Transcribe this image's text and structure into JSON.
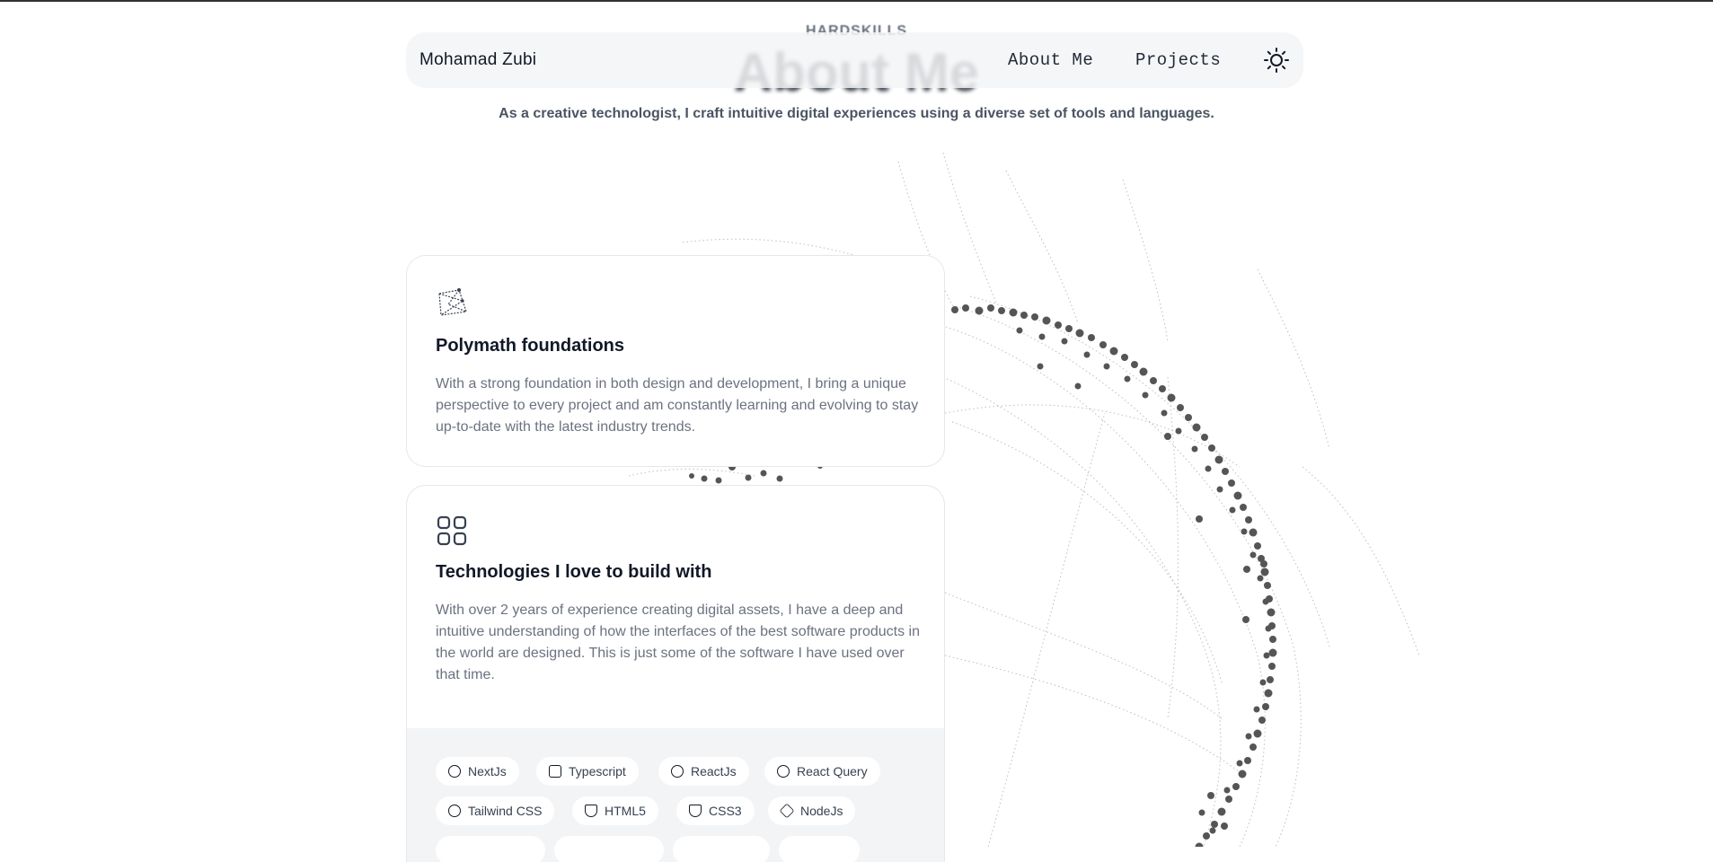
{
  "header": {
    "kicker": "HARDSKILLS",
    "title": "About Me",
    "subtitle": "As a creative technologist, I craft intuitive digital experiences using a diverse set of tools and languages."
  },
  "navbar": {
    "brand": "Mohamad Zubi",
    "links": [
      "About Me",
      "Projects"
    ],
    "theme_icon": "sun-icon"
  },
  "cards": [
    {
      "icon": "constellation-icon",
      "title": "Polymath foundations",
      "description": "With a strong foundation in both design and development, I bring a unique perspective to every project and am constantly learning and evolving to stay up-to-date with the latest industry trends."
    },
    {
      "icon": "grid-icon",
      "title": "Technologies I love to build with",
      "description": "With over 2 years of experience creating digital assets, I have a deep and intuitive understanding of how the interfaces of the best software products in the world are designed. This is just some of the software I have used over that time."
    }
  ],
  "technologies": [
    "NextJs",
    "Typescript",
    "ReactJs",
    "React Query",
    "Tailwind CSS",
    "HTML5",
    "CSS3",
    "NodeJs"
  ],
  "colors": {
    "navbar_bg": "#f3f4f6",
    "tech_bg": "#f3f4f6",
    "text_muted": "#6b7280",
    "dots": "#555555"
  }
}
